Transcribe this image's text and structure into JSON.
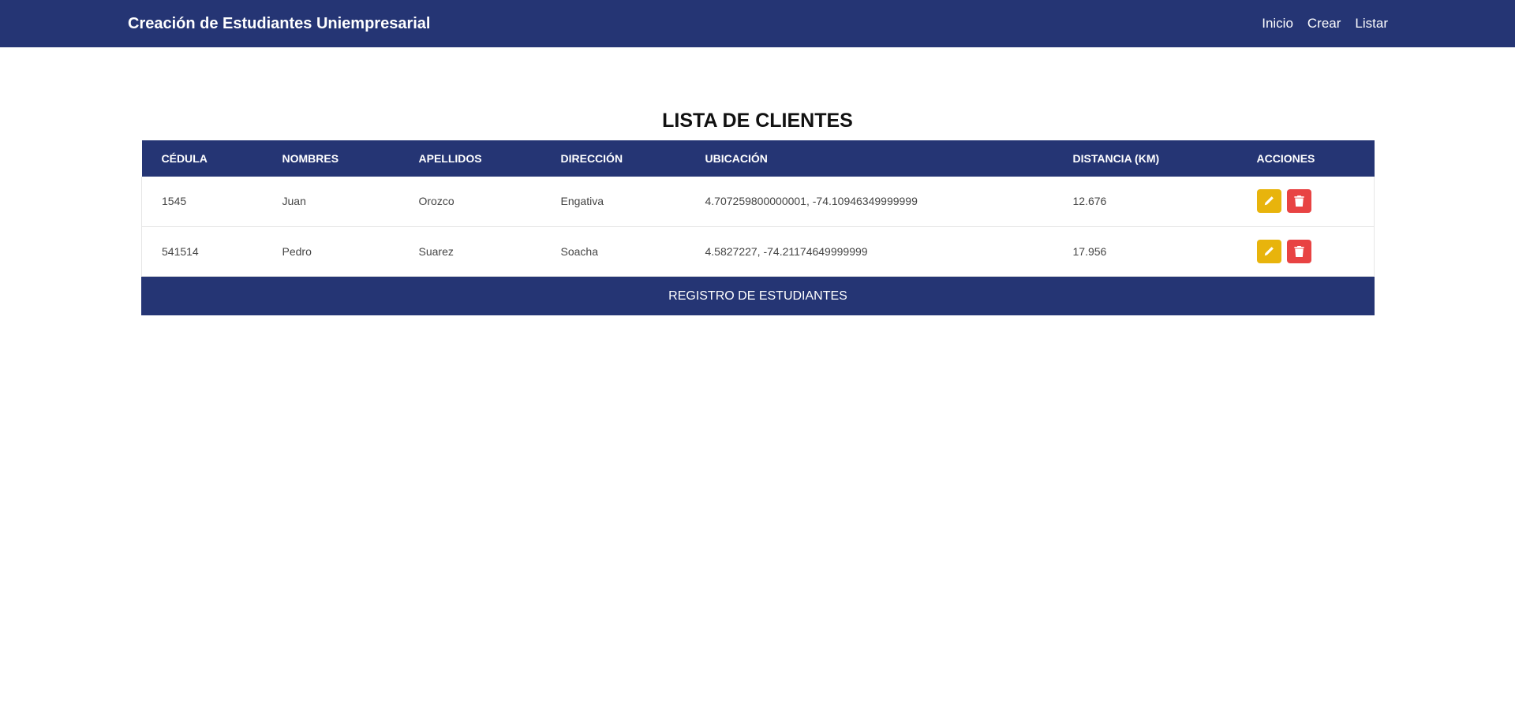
{
  "navbar": {
    "brand": "Creación de Estudiantes Uniempresarial",
    "links": [
      "Inicio",
      "Crear",
      "Listar"
    ]
  },
  "page": {
    "title": "LISTA DE CLIENTES"
  },
  "table": {
    "headers": [
      "CÉDULA",
      "NOMBRES",
      "APELLIDOS",
      "DIRECCIÓN",
      "UBICACIÓN",
      "DISTANCIA (KM)",
      "ACCIONES"
    ],
    "rows": [
      {
        "cedula": "1545",
        "nombres": "Juan",
        "apellidos": "Orozco",
        "direccion": "Engativa",
        "ubicacion": "4.707259800000001, -74.10946349999999",
        "distancia": "12.676"
      },
      {
        "cedula": "541514",
        "nombres": "Pedro",
        "apellidos": "Suarez",
        "direccion": "Soacha",
        "ubicacion": "4.5827227, -74.21174649999999",
        "distancia": "17.956"
      }
    ],
    "actions": {
      "edit_icon": "pencil-icon",
      "delete_icon": "trash-icon"
    }
  },
  "footer": {
    "label": "REGISTRO DE ESTUDIANTES"
  },
  "colors": {
    "primary": "#253574",
    "edit": "#e8b40c",
    "delete": "#e84343"
  }
}
